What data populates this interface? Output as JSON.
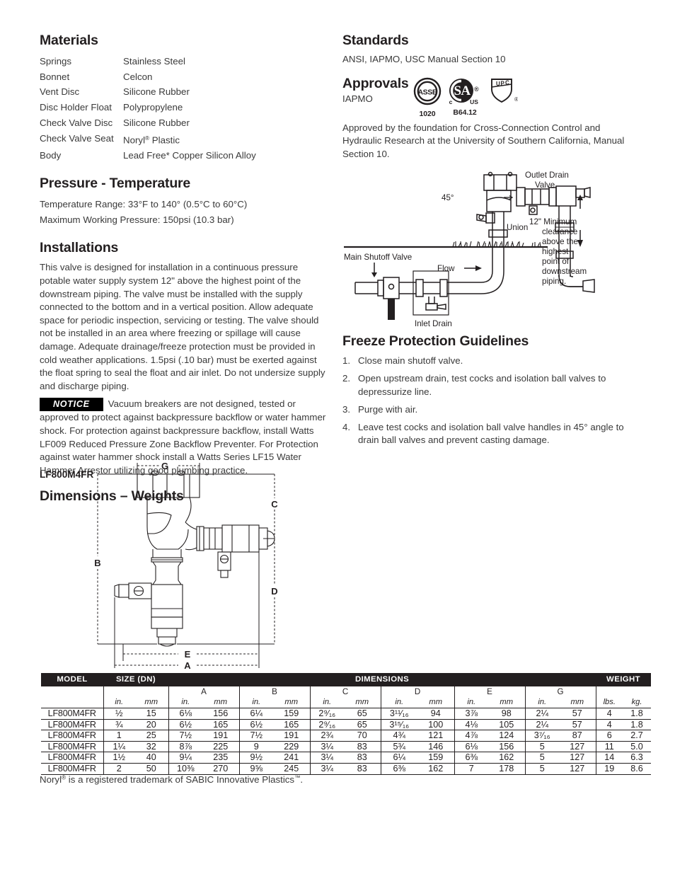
{
  "materials": {
    "heading": "Materials",
    "rows": [
      {
        "part": "Springs",
        "material": "Stainless Steel"
      },
      {
        "part": "Bonnet",
        "material": "Celcon"
      },
      {
        "part": "Vent Disc",
        "material": "Silicone Rubber"
      },
      {
        "part": "Disc Holder Float",
        "material": "Polypropylene"
      },
      {
        "part": "Check Valve Disc",
        "material": "Silicone Rubber"
      },
      {
        "part": "Check Valve Seat",
        "material": "Noryl® Plastic"
      },
      {
        "part": "Body",
        "material": "Lead Free* Copper Silicon Alloy"
      }
    ]
  },
  "pressure_temperature": {
    "heading": "Pressure - Temperature",
    "temperature_range": "Temperature Range: 33°F to 140° (0.5°C to 60°C)",
    "max_working_pressure": "Maximum Working Pressure: 150psi (10.3 bar)"
  },
  "installations": {
    "heading": "Installations",
    "body": "This valve is designed for installation in a continuous pressure potable water supply system 12\" above the highest point of the downstream piping. The valve must be installed with the supply connected to the bottom and in a vertical position. Allow adequate space for periodic inspection, servicing or testing. The valve should not be installed in an area where freezing or spillage will cause damage. Adequate drainage/freeze protection must be provided in cold weather applications. 1.5psi (.10 bar) must be exerted against the float spring to seal the float and air inlet. Do not undersize supply and discharge piping."
  },
  "notice": {
    "badge": "NOTICE",
    "text": "Vacuum breakers are not designed, tested or approved to protect against backpressure backflow or water hammer shock. For protection against backpressure backflow, install Watts LF009 Reduced Pressure Zone Backflow Preventer. For Protection against water hammer shock install a Watts Series LF15 Water Hammer Arrestor utilizing good plumbing practice."
  },
  "standards": {
    "heading": "Standards",
    "text": "ANSI, IAPMO, USC Manual Section 10"
  },
  "approvals": {
    "heading": "Approvals",
    "agency": "IAPMO",
    "logos": [
      {
        "name": "asse-logo",
        "mark": "ASSE",
        "caption": "1020"
      },
      {
        "name": "csa-logo",
        "mark": "CSA",
        "caption": "B64.12",
        "prefix": "c",
        "suffix": "us"
      },
      {
        "name": "upc-logo",
        "mark": "UPC",
        "caption": ""
      }
    ],
    "note": "Approved by the foundation for Cross-Connection Control and Hydraulic Research at the University of Southern California, Manual Section 10."
  },
  "install_diagram": {
    "labels": {
      "angle": "45°",
      "outlet_drain_valve": "Outlet Drain\nValve",
      "outlet_drain_valve_l1": "Outlet Drain",
      "outlet_drain_valve_l2": "Valve",
      "union": "Union",
      "clearance": "12\" Minimum\nclearance\nabove the\nhighest\npoint of\ndownstream\npiping.",
      "clearance_lines": [
        "12\" Minimum",
        "clearance",
        "above the",
        "highest",
        "point of",
        "downstream",
        "piping."
      ],
      "main_shutoff_valve": "Main Shutoff Valve",
      "flow": "Flow",
      "inlet_drain": "Inlet Drain"
    }
  },
  "freeze": {
    "heading": "Freeze Protection Guidelines",
    "steps": [
      {
        "num": "1.",
        "text": "Close main shutoff valve."
      },
      {
        "num": "2.",
        "text": "Open upstream drain, test cocks and isolation ball valves to depressurize line."
      },
      {
        "num": "3.",
        "text": "Purge with air."
      },
      {
        "num": "4.",
        "text": "Leave test cocks and isolation ball valve handles in 45° angle to drain ball valves and prevent casting damage."
      }
    ]
  },
  "dimensions": {
    "heading": "Dimensions – Weights",
    "model_label": "LF800M4FR",
    "callouts": [
      "A",
      "B",
      "C",
      "D",
      "E",
      "G"
    ]
  },
  "spec_table": {
    "group_headers": {
      "model": "MODEL",
      "size": "SIZE (DN)",
      "dimensions": "DIMENSIONS",
      "weight": "WEIGHT"
    },
    "letter_headers": [
      "",
      "",
      "A",
      "B",
      "C",
      "D",
      "E",
      "G",
      ""
    ],
    "unit_headers": [
      "in.",
      "mm",
      "in.",
      "mm",
      "in.",
      "mm",
      "in.",
      "mm",
      "in.",
      "mm",
      "in.",
      "mm",
      "in.",
      "mm",
      "lbs.",
      "kg."
    ],
    "rows": [
      {
        "model": "LF800M4FR",
        "size_in": "½",
        "size_mm": "15",
        "a_in": "6⅛",
        "a_mm": "156",
        "b_in": "6¼",
        "b_mm": "159",
        "c_in": "2⁹⁄₁₆",
        "c_mm": "65",
        "d_in": "3¹¹⁄₁₆",
        "d_mm": "94",
        "e_in": "3⅞",
        "e_mm": "98",
        "g_in": "2¼",
        "g_mm": "57",
        "lbs": "4",
        "kg": "1.8"
      },
      {
        "model": "LF800M4FR",
        "size_in": "¾",
        "size_mm": "20",
        "a_in": "6½",
        "a_mm": "165",
        "b_in": "6½",
        "b_mm": "165",
        "c_in": "2⁹⁄₁₆",
        "c_mm": "65",
        "d_in": "3¹⁵⁄₁₆",
        "d_mm": "100",
        "e_in": "4⅛",
        "e_mm": "105",
        "g_in": "2¼",
        "g_mm": "57",
        "lbs": "4",
        "kg": "1.8"
      },
      {
        "model": "LF800M4FR",
        "size_in": "1",
        "size_mm": "25",
        "a_in": "7½",
        "a_mm": "191",
        "b_in": "7½",
        "b_mm": "191",
        "c_in": "2¾",
        "c_mm": "70",
        "d_in": "4¾",
        "d_mm": "121",
        "e_in": "4⅞",
        "e_mm": "124",
        "g_in": "3⁷⁄₁₆",
        "g_mm": "87",
        "lbs": "6",
        "kg": "2.7"
      },
      {
        "model": "LF800M4FR",
        "size_in": "1¼",
        "size_mm": "32",
        "a_in": "8⅞",
        "a_mm": "225",
        "b_in": "9",
        "b_mm": "229",
        "c_in": "3¼",
        "c_mm": "83",
        "d_in": "5¾",
        "d_mm": "146",
        "e_in": "6⅛",
        "e_mm": "156",
        "g_in": "5",
        "g_mm": "127",
        "lbs": "11",
        "kg": "5.0"
      },
      {
        "model": "LF800M4FR",
        "size_in": "1½",
        "size_mm": "40",
        "a_in": "9¼",
        "a_mm": "235",
        "b_in": "9½",
        "b_mm": "241",
        "c_in": "3¼",
        "c_mm": "83",
        "d_in": "6¼",
        "d_mm": "159",
        "e_in": "6⅜",
        "e_mm": "162",
        "g_in": "5",
        "g_mm": "127",
        "lbs": "14",
        "kg": "6.3"
      },
      {
        "model": "LF800M4FR",
        "size_in": "2",
        "size_mm": "50",
        "a_in": "10⅜",
        "a_mm": "270",
        "b_in": "9⅝",
        "b_mm": "245",
        "c_in": "3¼",
        "c_mm": "83",
        "d_in": "6⅜",
        "d_mm": "162",
        "e_in": "7",
        "e_mm": "178",
        "g_in": "5",
        "g_mm": "127",
        "lbs": "19",
        "kg": "8.6"
      }
    ]
  },
  "footnote": "Noryl® is a registered trademark of SABIC Innovative Plastics™."
}
